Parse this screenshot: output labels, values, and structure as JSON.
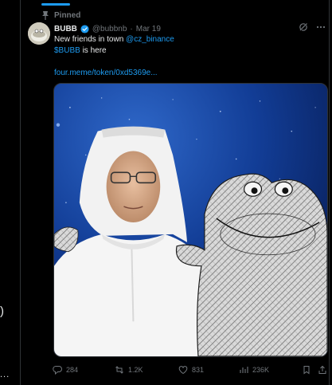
{
  "pinned": {
    "label": "Pinned"
  },
  "tweet": {
    "display_name": "BUBB",
    "handle": "@bubbnb",
    "separator": "·",
    "date": "Mar 19",
    "text_line1_prefix": "New friends in town ",
    "mention": "@cz_binance",
    "cashtag": "$BUBB",
    "text_line2_suffix": " is here",
    "link": "four.meme/token/0xd5369e..."
  },
  "actions": {
    "replies": "284",
    "reposts": "1.2K",
    "likes": "831",
    "views": "236K"
  },
  "colors": {
    "accent": "#1d9bf0",
    "muted": "#71767b",
    "text": "#e7e9ea",
    "background": "#000000"
  },
  "left_rail": {
    "glyph": ")",
    "more": "..."
  }
}
